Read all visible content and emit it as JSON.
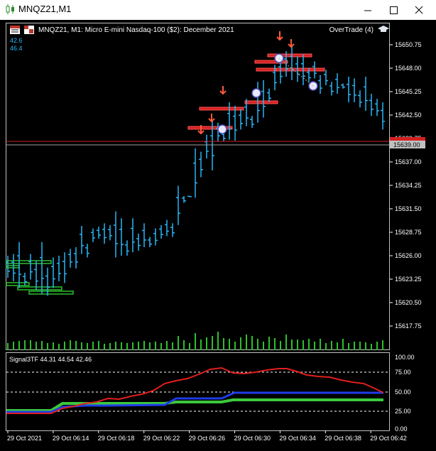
{
  "window": {
    "title": "MNQZ21,M1"
  },
  "chart": {
    "header": "MNQZ21, M1:  Micro E-mini Nasdaq-100 ($2): December 2021",
    "ea_label": "OverTrade (4)",
    "info_line1": "42.6",
    "info_line2": "46.4",
    "current_price": "15639.00",
    "price_labels": [
      "15650.75",
      "15648.00",
      "15645.25",
      "15642.50",
      "15639.75",
      "15637.00",
      "15634.25",
      "15631.50",
      "15628.75",
      "15626.00",
      "15623.25",
      "15620.50",
      "15617.75"
    ]
  },
  "indicator": {
    "label": "Signal3TF 44.31 44.54 42.46",
    "levels": [
      "100.00",
      "75.00",
      "50.00",
      "25.00",
      "0.00"
    ]
  },
  "time_labels": [
    "29 Oct 2021",
    "29 Oct 06:14",
    "29 Oct 06:18",
    "29 Oct 06:22",
    "29 Oct 06:26",
    "29 Oct 06:30",
    "29 Oct 06:34",
    "29 Oct 06:38",
    "29 Oct 06:42"
  ],
  "colors": {
    "bar": "#29b6f6",
    "sell_zone": "#cc1f1f",
    "buy_zone": "#1f9e1f",
    "arrow": "#ff5a3c",
    "red_line": "#e0201c",
    "blue_line": "#1f3ce6",
    "green_line": "#3cc83c",
    "grid_text": "#ffffff",
    "current_price_bg": "#c0c0c0"
  },
  "chart_data": {
    "type": "ohlc",
    "series": [
      {
        "high": 15626.0,
        "low": 15623.4
      },
      {
        "high": 15626.2,
        "low": 15623.0
      },
      {
        "high": 15627.6,
        "low": 15622.2
      },
      {
        "high": 15624.0,
        "low": 15622.5
      },
      {
        "high": 15626.2,
        "low": 15623.2
      },
      {
        "high": 15625.4,
        "low": 15622.0
      },
      {
        "high": 15627.6,
        "low": 15621.5
      },
      {
        "high": 15624.6,
        "low": 15621.3
      },
      {
        "high": 15625.8,
        "low": 15622.2
      },
      {
        "high": 15626.0,
        "low": 15623.0
      },
      {
        "high": 15626.4,
        "low": 15622.8
      },
      {
        "high": 15626.8,
        "low": 15624.6
      },
      {
        "high": 15627.0,
        "low": 15624.5
      },
      {
        "high": 15629.5,
        "low": 15626.2
      },
      {
        "high": 15627.4,
        "low": 15625.8
      },
      {
        "high": 15629.2,
        "low": 15627.6
      },
      {
        "high": 15629.4,
        "low": 15628.0
      },
      {
        "high": 15629.8,
        "low": 15627.4
      },
      {
        "high": 15629.6,
        "low": 15627.8
      },
      {
        "high": 15631.2,
        "low": 15625.8
      },
      {
        "high": 15630.4,
        "low": 15626.0
      },
      {
        "high": 15627.8,
        "low": 15626.0
      },
      {
        "high": 15630.4,
        "low": 15626.4
      },
      {
        "high": 15628.6,
        "low": 15626.6
      },
      {
        "high": 15629.8,
        "low": 15627.0
      },
      {
        "high": 15628.2,
        "low": 15627.0
      },
      {
        "high": 15629.2,
        "low": 15627.2
      },
      {
        "high": 15629.6,
        "low": 15628.0
      },
      {
        "high": 15630.2,
        "low": 15628.3
      },
      {
        "high": 15629.8,
        "low": 15628.2
      },
      {
        "high": 15634.2,
        "low": 15629.6
      },
      {
        "high": 15633.0,
        "low": 15632.2
      },
      {
        "high": 15633.0,
        "low": 15633.2
      },
      {
        "high": 15638.6,
        "low": 15632.8
      },
      {
        "high": 15638.2,
        "low": 15635.2
      },
      {
        "high": 15640.2,
        "low": 15637.4
      },
      {
        "high": 15641.8,
        "low": 15636.0
      },
      {
        "high": 15641.6,
        "low": 15639.4
      },
      {
        "high": 15640.6,
        "low": 15639.4
      },
      {
        "high": 15644.0,
        "low": 15639.6
      },
      {
        "high": 15643.6,
        "low": 15639.5
      },
      {
        "high": 15643.2,
        "low": 15640.8
      },
      {
        "high": 15644.4,
        "low": 15641.2
      },
      {
        "high": 15642.4,
        "low": 15641.0
      },
      {
        "high": 15646.4,
        "low": 15641.6
      },
      {
        "high": 15646.6,
        "low": 15642.2
      },
      {
        "high": 15645.6,
        "low": 15644.0
      },
      {
        "high": 15648.4,
        "low": 15645.4
      },
      {
        "high": 15649.0,
        "low": 15646.2
      },
      {
        "high": 15650.0,
        "low": 15647.0
      },
      {
        "high": 15650.6,
        "low": 15646.6
      },
      {
        "high": 15649.4,
        "low": 15646.4
      },
      {
        "high": 15649.6,
        "low": 15646.0
      },
      {
        "high": 15648.0,
        "low": 15646.4
      },
      {
        "high": 15648.8,
        "low": 15646.8
      },
      {
        "high": 15647.2,
        "low": 15645.0
      },
      {
        "high": 15647.8,
        "low": 15646.0
      },
      {
        "high": 15646.4,
        "low": 15644.8
      },
      {
        "high": 15647.4,
        "low": 15645.0
      },
      {
        "high": 15646.2,
        "low": 15645.6
      },
      {
        "high": 15647.0,
        "low": 15644.0
      },
      {
        "high": 15646.8,
        "low": 15644.0
      },
      {
        "high": 15645.4,
        "low": 15643.4
      },
      {
        "high": 15647.0,
        "low": 15643.0
      },
      {
        "high": 15645.0,
        "low": 15642.4
      },
      {
        "high": 15644.4,
        "low": 15642.4
      },
      {
        "high": 15644.0,
        "low": 15640.8
      }
    ]
  }
}
